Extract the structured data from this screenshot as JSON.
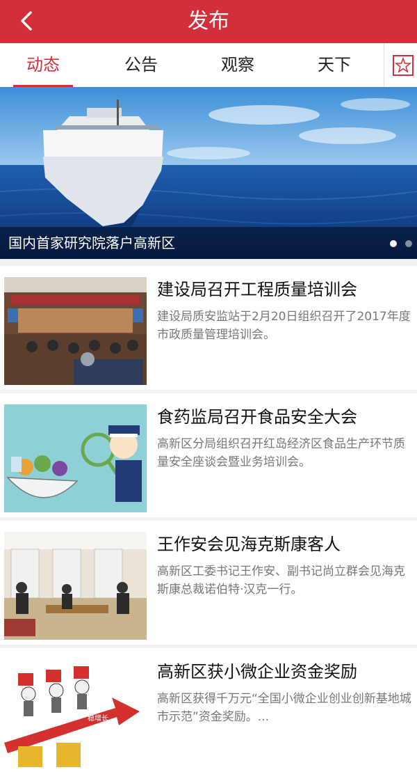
{
  "header": {
    "title": "发布",
    "back_icon": "chevron-left-icon"
  },
  "tabs": [
    {
      "label": "动态",
      "active": true
    },
    {
      "label": "公告",
      "active": false
    },
    {
      "label": "观察",
      "active": false
    },
    {
      "label": "天下",
      "active": false
    }
  ],
  "favorite_icon": "star-icon",
  "banner": {
    "caption": "国内首家研究院落户高新区",
    "page_count": 2,
    "active_page": 1
  },
  "news": [
    {
      "title": "建设局召开工程质量培训会",
      "summary": "建设局质安监站于2月20日组织召开了2017年度市政质量管理培训会。"
    },
    {
      "title": "食药监局召开食品安全大会",
      "summary": "高新区分局组织召开红岛经济区食品生产环节质量安全座谈会暨业务培训会。"
    },
    {
      "title": "王作安会见海克斯康客人",
      "summary": "高新区工委书记王作安、副书记尚立群会见海克斯康总裁诺伯特·汉克一行。"
    },
    {
      "title": "高新区获小微企业资金奖励",
      "summary": "高新区获得千万元“全国小微企业创业创新基地城市示范”资金奖励。..."
    }
  ],
  "thumb4_label": "稳增长",
  "colors": {
    "brand": "#d32f3b",
    "text": "#111111",
    "muted": "#777777"
  }
}
